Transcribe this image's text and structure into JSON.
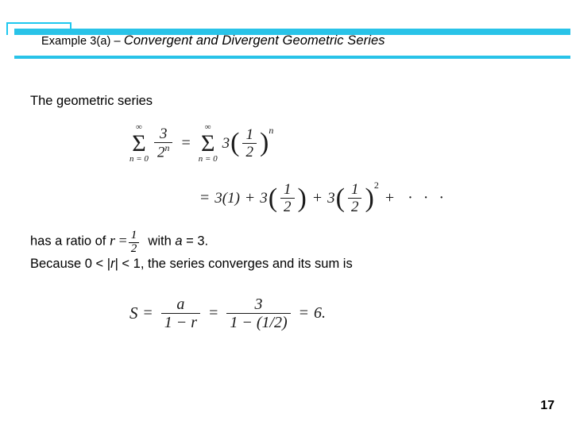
{
  "slide": {
    "title": {
      "prefix": "Example 3(a) – ",
      "emphasis": "Convergent and Divergent Geometric Series"
    },
    "body": {
      "line1": "The geometric series",
      "line2_pre": "has a ratio of",
      "line2_r_var": "r",
      "line2_eq": "=",
      "line2_frac_num": "1",
      "line2_frac_den": "2",
      "line2_post": "with a = 3.",
      "line3": "Because 0 < |r| < 1, the series converges and its sum is"
    },
    "equation1": {
      "sum_upper": "∞",
      "sum_lower_left": "n = 0",
      "term_num": "3",
      "term_den": "2",
      "term_den_exp": "n",
      "equals": "=",
      "sum2_upper": "∞",
      "sum2_lower": "n = 0",
      "coeff2": "3",
      "frac2_num": "1",
      "frac2_den": "2",
      "exp2": "n",
      "row2_equals": "=",
      "row2_t1": "3(1)",
      "row2_plus1": "+",
      "row2_t2_coeff": "3",
      "row2_t2_num": "1",
      "row2_t2_den": "2",
      "row2_plus2": "+",
      "row2_t3_coeff": "3",
      "row2_t3_num": "1",
      "row2_t3_den": "2",
      "row2_t3_exp": "2",
      "row2_plus3": "+",
      "row2_dots": "· · ·"
    },
    "equation2": {
      "S": "S",
      "eq1": "=",
      "frac1_num": "a",
      "frac1_den": "1 − r",
      "eq2": "=",
      "frac2_num": "3",
      "frac2_den": "1 − (1/2)",
      "eq3": "=",
      "result": "6."
    },
    "page_number": "17",
    "colors": {
      "accent": "#29c3e8",
      "accent_outline": "#1ec8ef",
      "text": "#000000",
      "math": "#1a1a1a"
    }
  }
}
